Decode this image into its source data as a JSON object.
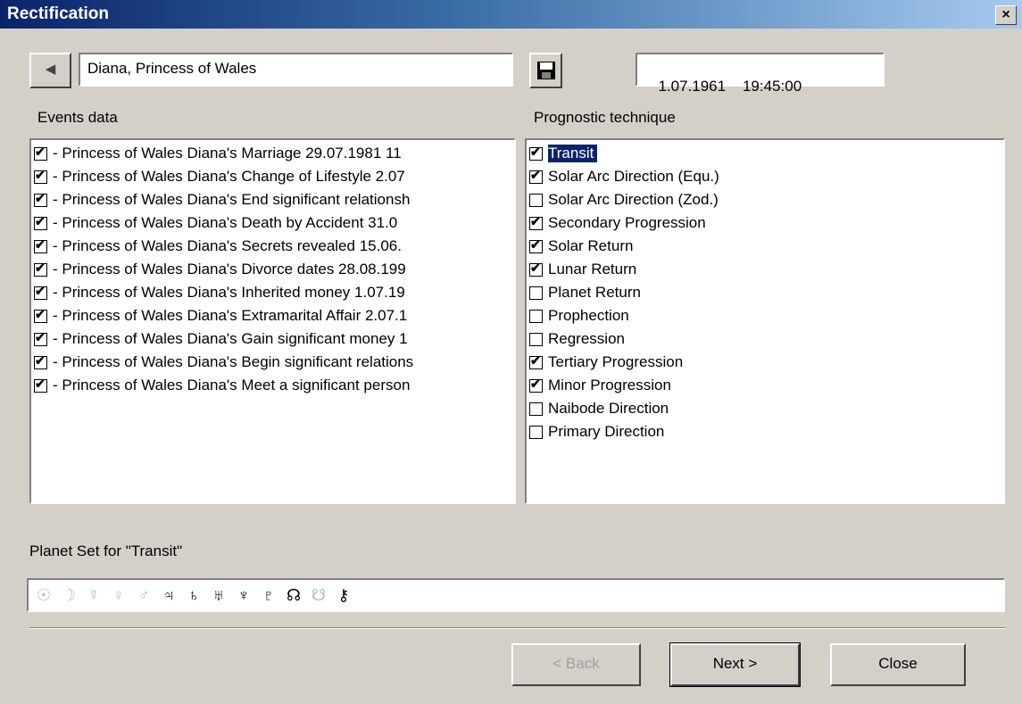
{
  "window": {
    "title": "Rectification",
    "close_glyph": "×"
  },
  "toolbar": {
    "back_glyph": "◀",
    "person_name": "Diana, Princess of Wales",
    "save_glyph": "💾",
    "datetime": "1.07.1961    19:45:00"
  },
  "events": {
    "label": "Events data",
    "items": [
      {
        "text": " - Princess of Wales Diana's Marriage  29.07.1981  11",
        "checked": true
      },
      {
        "text": " - Princess of Wales Diana's Change of Lifestyle   2.07",
        "checked": true
      },
      {
        "text": " - Princess of Wales Diana's End significant relationsh",
        "checked": true
      },
      {
        "text": " - Princess of Wales Diana's Death by Accident  31.0",
        "checked": true
      },
      {
        "text": " - Princess of Wales Diana's Secrets revealed  15.06.",
        "checked": true
      },
      {
        "text": " - Princess of Wales Diana's Divorce dates  28.08.199",
        "checked": true
      },
      {
        "text": " - Princess of Wales Diana's Inherited money   1.07.19",
        "checked": true
      },
      {
        "text": " - Princess of Wales Diana's Extramarital Affair   2.07.1",
        "checked": true
      },
      {
        "text": " - Princess of Wales Diana's Gain significant money  1",
        "checked": true
      },
      {
        "text": " - Princess of Wales Diana's Begin significant relations",
        "checked": true
      },
      {
        "text": " - Princess of Wales Diana's Meet a significant person",
        "checked": true
      }
    ]
  },
  "techniques": {
    "label": "Prognostic technique",
    "items": [
      {
        "text": "Transit",
        "checked": true,
        "selected": true
      },
      {
        "text": "Solar Arc Direction (Equ.)",
        "checked": true
      },
      {
        "text": "Solar Arc Direction (Zod.)",
        "checked": false
      },
      {
        "text": "Secondary Progression",
        "checked": true
      },
      {
        "text": "Solar Return",
        "checked": true
      },
      {
        "text": "Lunar Return",
        "checked": true
      },
      {
        "text": "Planet Return",
        "checked": false
      },
      {
        "text": "Prophection",
        "checked": false
      },
      {
        "text": "Regression",
        "checked": false
      },
      {
        "text": "Tertiary Progression",
        "checked": true
      },
      {
        "text": "Minor Progression",
        "checked": true
      },
      {
        "text": "Naibode Direction",
        "checked": false
      },
      {
        "text": "Primary Direction",
        "checked": false
      }
    ]
  },
  "planet_set": {
    "label": "Planet Set for \"Transit\"",
    "planets": [
      {
        "glyph": "☉",
        "name": "sun",
        "enabled": false
      },
      {
        "glyph": "☽",
        "name": "moon",
        "enabled": false
      },
      {
        "glyph": "☿",
        "name": "mercury",
        "enabled": false
      },
      {
        "glyph": "♀",
        "name": "venus",
        "enabled": false
      },
      {
        "glyph": "♂",
        "name": "mars",
        "enabled": false
      },
      {
        "glyph": "♃",
        "name": "jupiter",
        "enabled": true
      },
      {
        "glyph": "♄",
        "name": "saturn",
        "enabled": true
      },
      {
        "glyph": "♅",
        "name": "uranus",
        "enabled": true
      },
      {
        "glyph": "♆",
        "name": "neptune",
        "enabled": true
      },
      {
        "glyph": "♇",
        "name": "pluto",
        "enabled": true
      },
      {
        "glyph": "☊",
        "name": "north-node",
        "enabled": true
      },
      {
        "glyph": "☋",
        "name": "south-node",
        "enabled": false
      },
      {
        "glyph": "⚷",
        "name": "chiron",
        "enabled": true
      }
    ]
  },
  "buttons": {
    "back": "< Back",
    "next": "Next >",
    "close": "Close"
  }
}
